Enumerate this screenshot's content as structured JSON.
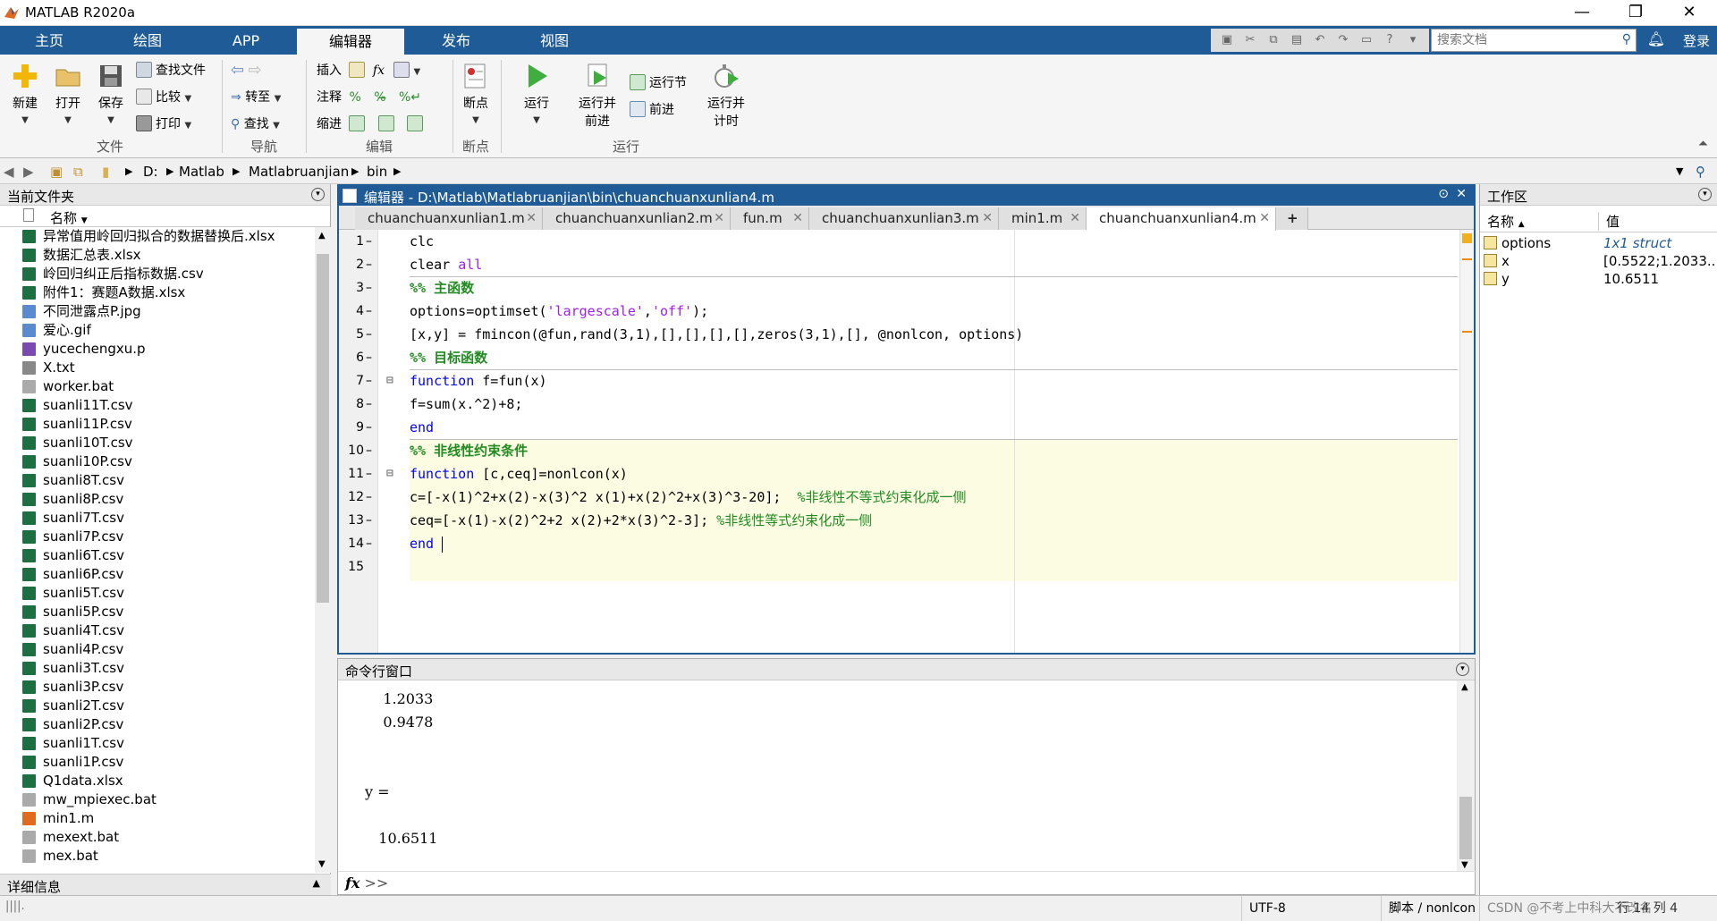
{
  "window": {
    "title": "MATLAB R2020a"
  },
  "tabs": [
    "主页",
    "绘图",
    "APP",
    "编辑器",
    "发布",
    "视图"
  ],
  "search": {
    "placeholder": "搜索文档"
  },
  "login": "登录",
  "ribbon": {
    "file": {
      "new": "新建",
      "open": "打开",
      "save": "保存",
      "find_files": "查找文件",
      "compare": "比较",
      "print": "打印",
      "group": "文件"
    },
    "nav": {
      "goto": "转至",
      "find": "查找",
      "group": "导航"
    },
    "edit": {
      "insert": "插入",
      "comment": "注释",
      "indent": "缩进",
      "fx": "fx",
      "group": "编辑"
    },
    "breakpoints": {
      "label": "断点",
      "group": "断点"
    },
    "run": {
      "run": "运行",
      "run_advance_1": "运行并",
      "run_advance_2": "前进",
      "run_section": "运行节",
      "advance": "前进",
      "run_time_1": "运行并",
      "run_time_2": "计时",
      "group": "运行"
    }
  },
  "address": {
    "crumbs": [
      "D:",
      "Matlab",
      "Matlabruanjian",
      "bin"
    ]
  },
  "current_folder": {
    "title": "当前文件夹",
    "col_name": "名称",
    "files": [
      {
        "name": "异常值用岭回归拟合的数据替换后.xlsx",
        "type": "xlsx"
      },
      {
        "name": "数据汇总表.xlsx",
        "type": "xlsx"
      },
      {
        "name": "岭回归纠正后指标数据.csv",
        "type": "csv"
      },
      {
        "name": "附件1：赛题A数据.xlsx",
        "type": "xlsx"
      },
      {
        "name": "不同泄露点P.jpg",
        "type": "img"
      },
      {
        "name": "爱心.gif",
        "type": "img"
      },
      {
        "name": "yucechengxu.p",
        "type": "p"
      },
      {
        "name": "X.txt",
        "type": "txt"
      },
      {
        "name": "worker.bat",
        "type": "bat"
      },
      {
        "name": "suanli11T.csv",
        "type": "csv"
      },
      {
        "name": "suanli11P.csv",
        "type": "csv"
      },
      {
        "name": "suanli10T.csv",
        "type": "csv"
      },
      {
        "name": "suanli10P.csv",
        "type": "csv"
      },
      {
        "name": "suanli8T.csv",
        "type": "csv"
      },
      {
        "name": "suanli8P.csv",
        "type": "csv"
      },
      {
        "name": "suanli7T.csv",
        "type": "csv"
      },
      {
        "name": "suanli7P.csv",
        "type": "csv"
      },
      {
        "name": "suanli6T.csv",
        "type": "csv"
      },
      {
        "name": "suanli6P.csv",
        "type": "csv"
      },
      {
        "name": "suanli5T.csv",
        "type": "csv"
      },
      {
        "name": "suanli5P.csv",
        "type": "csv"
      },
      {
        "name": "suanli4T.csv",
        "type": "csv"
      },
      {
        "name": "suanli4P.csv",
        "type": "csv"
      },
      {
        "name": "suanli3T.csv",
        "type": "csv"
      },
      {
        "name": "suanli3P.csv",
        "type": "csv"
      },
      {
        "name": "suanli2T.csv",
        "type": "csv"
      },
      {
        "name": "suanli2P.csv",
        "type": "csv"
      },
      {
        "name": "suanli1T.csv",
        "type": "csv"
      },
      {
        "name": "suanli1P.csv",
        "type": "csv"
      },
      {
        "name": "Q1data.xlsx",
        "type": "xlsx"
      },
      {
        "name": "mw_mpiexec.bat",
        "type": "bat"
      },
      {
        "name": "min1.m",
        "type": "m"
      },
      {
        "name": "mexext.bat",
        "type": "bat"
      },
      {
        "name": "mex.bat",
        "type": "bat"
      }
    ],
    "details": "详细信息"
  },
  "editor": {
    "header": "编辑器 - D:\\Matlab\\Matlabruanjian\\bin\\chuanchuanxunlian4.m",
    "tabs": [
      "chuanchuanxunlian1.m",
      "chuanchuanxunlian2.m",
      "fun.m",
      "chuanchuanxunlian3.m",
      "min1.m",
      "chuanchuanxunlian4.m"
    ],
    "add_tab": "+",
    "lines": [
      [
        {
          "t": "clc",
          "c": ""
        }
      ],
      [
        {
          "t": "clear ",
          "c": ""
        },
        {
          "t": "all",
          "c": "str"
        }
      ],
      [
        {
          "t": "%% 主函数",
          "c": "sec"
        }
      ],
      [
        {
          "t": "options=optimset(",
          "c": ""
        },
        {
          "t": "'largescale'",
          "c": "str"
        },
        {
          "t": ",",
          "c": ""
        },
        {
          "t": "'off'",
          "c": "str"
        },
        {
          "t": ");",
          "c": ""
        }
      ],
      [
        {
          "t": "[x,y] = fmincon(@fun,rand(3,1),[],[],[],[],zeros(3,1),[], @nonlcon, options)",
          "c": ""
        }
      ],
      [
        {
          "t": "%% 目标函数",
          "c": "sec"
        }
      ],
      [
        {
          "t": "function",
          "c": "kw"
        },
        {
          "t": " f=fun(x)",
          "c": ""
        }
      ],
      [
        {
          "t": "f=sum(x.^2)+8;",
          "c": ""
        }
      ],
      [
        {
          "t": "end",
          "c": "kw"
        }
      ],
      [
        {
          "t": "%% 非线性约束条件",
          "c": "sec"
        }
      ],
      [
        {
          "t": "function",
          "c": "kw"
        },
        {
          "t": " [c,ceq]=nonlcon(x)",
          "c": ""
        }
      ],
      [
        {
          "t": "c=[-x(1)^2+x(2)-x(3)^2 x(1)+x(2)^2+x(3)^3-20];  ",
          "c": ""
        },
        {
          "t": "%非线性不等式约束化成一侧",
          "c": "cm"
        }
      ],
      [
        {
          "t": "ceq=[-x(1)-x(2)^2+2 x(2)+2*x(3)^2-3]; ",
          "c": ""
        },
        {
          "t": "%非线性等式约束化成一侧",
          "c": "cm"
        }
      ],
      [
        {
          "t": "end",
          "c": "kw"
        }
      ],
      []
    ]
  },
  "command_window": {
    "title": "命令行窗口",
    "lines": [
      "    1.2033",
      "    0.9478",
      "",
      "",
      "y =",
      "",
      "   10.6511"
    ],
    "prompt": ">>"
  },
  "workspace": {
    "title": "工作区",
    "col_name": "名称",
    "col_value": "值",
    "vars": [
      {
        "name": "options",
        "value": "1x1 struct"
      },
      {
        "name": "x",
        "value": "[0.5522;1.2033..."
      },
      {
        "name": "y",
        "value": "10.6511"
      }
    ]
  },
  "status": {
    "encoding": "UTF-8",
    "mode": "脚本 / nonlcon",
    "position": "行 14  列 4",
    "watermark": "CSDN @不考上中科大不改名"
  },
  "colors": {
    "accent": "#1f5b96",
    "keyword": "#0000ff",
    "string": "#a020f0",
    "comment": "#228b22",
    "cell_band": "#fcfce2"
  }
}
